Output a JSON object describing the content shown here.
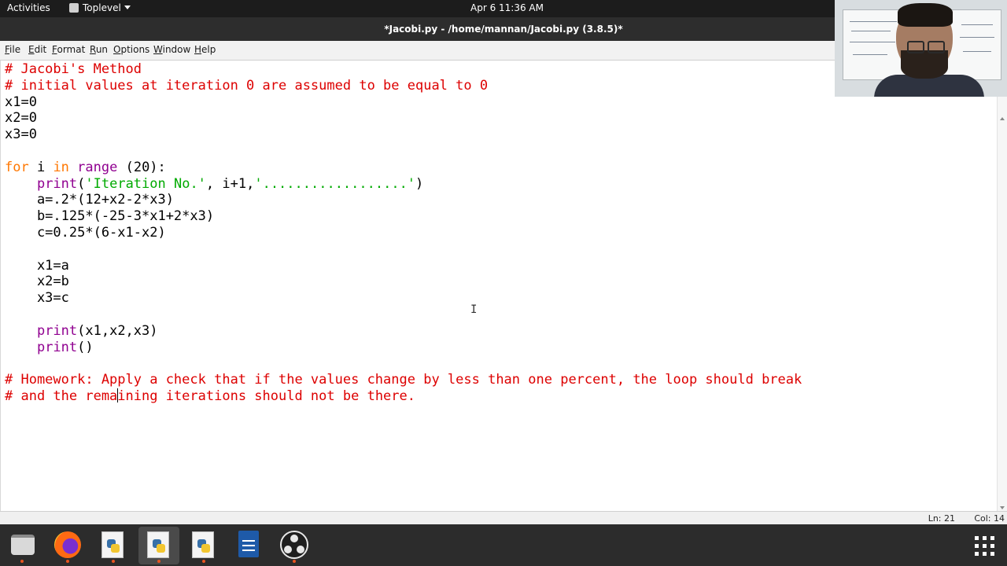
{
  "topbar": {
    "activities": "Activities",
    "app_name": "Toplevel",
    "clock": "Apr 6  11:36 AM"
  },
  "window": {
    "title": "*Jacobi.py - /home/mannan/Jacobi.py (3.8.5)*"
  },
  "menu": [
    {
      "label": "File",
      "key": "F",
      "rest": "ile"
    },
    {
      "label": "Edit",
      "key": "E",
      "rest": "dit"
    },
    {
      "label": "Format",
      "key": "F",
      "rest": "ormat"
    },
    {
      "label": "Run",
      "key": "R",
      "rest": "un"
    },
    {
      "label": "Options",
      "key": "O",
      "rest": "ptions"
    },
    {
      "label": "Window",
      "key": "W",
      "rest": "indow"
    },
    {
      "label": "Help",
      "key": "H",
      "rest": "elp"
    }
  ],
  "code": {
    "l1": "# Jacobi's Method",
    "l2": "# initial values at iteration 0 are assumed to be equal to 0",
    "l3": "x1=0",
    "l4": "x2=0",
    "l5": "x3=0",
    "l7_kw_for": "for",
    "l7_var": " i ",
    "l7_kw_in": "in",
    "l7_sp": " ",
    "l7_range": "range",
    "l7_rest": " (20):",
    "l8_indent": "    ",
    "l8_print": "print",
    "l8_open": "(",
    "l8_str1": "'Iteration No.'",
    "l8_mid": ", i+1,",
    "l8_str2": "'..................'",
    "l8_close": ")",
    "l9": "    a=.2*(12+x2-2*x3)",
    "l10": "    b=.125*(-25-3*x1+2*x3)",
    "l11": "    c=0.25*(6-x1-x2)",
    "l13": "    x1=a",
    "l14": "    x2=b",
    "l15": "    x3=c",
    "l17_indent": "    ",
    "l17_print": "print",
    "l17_rest": "(x1,x2,x3)",
    "l18_indent": "    ",
    "l18_print": "print",
    "l18_rest": "()",
    "l20": "# Homework: Apply a check that if the values change by less than one percent, the loop should break",
    "l21_before_caret": "# and the rema",
    "l21_after_caret": "ining iterations should not be there."
  },
  "status": {
    "line": "Ln: 21",
    "col": "Col: 14"
  },
  "dock": [
    {
      "name": "files",
      "icon": "files-icon"
    },
    {
      "name": "firefox",
      "icon": "firefox-icon"
    },
    {
      "name": "python-file-1",
      "icon": "python-file-icon"
    },
    {
      "name": "python-file-2",
      "icon": "python-file-icon",
      "active": true
    },
    {
      "name": "python-file-3",
      "icon": "python-file-icon"
    },
    {
      "name": "writer",
      "icon": "document-icon"
    },
    {
      "name": "obs-studio",
      "icon": "obs-icon"
    }
  ],
  "colors": {
    "keyword": "#ff7700",
    "builtin": "#900090",
    "string": "#00aa00",
    "comment": "#dd0000",
    "running_indicator": "#e95420"
  }
}
